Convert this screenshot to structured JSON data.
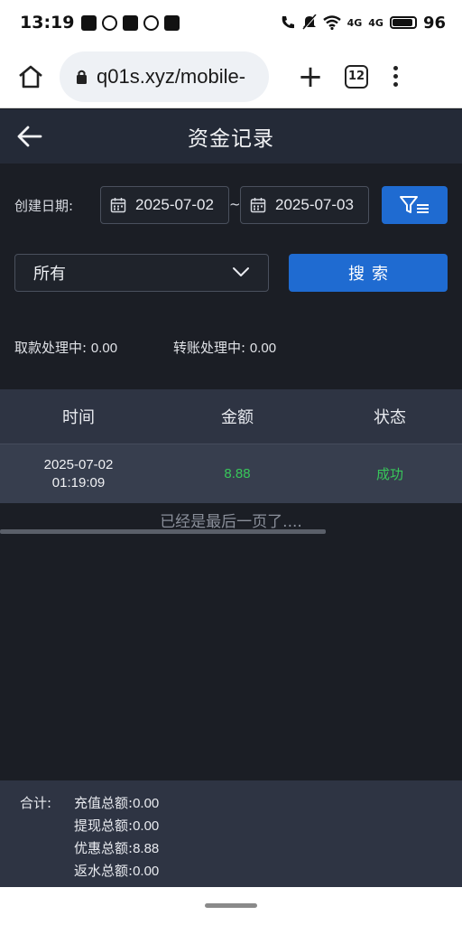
{
  "status_bar": {
    "time": "13:19",
    "battery": "96",
    "signal_labels": [
      "4G",
      "4G"
    ]
  },
  "browser": {
    "url": "q01s.xyz/mobile-",
    "tab_count": "12"
  },
  "header": {
    "title": "资金记录"
  },
  "filters": {
    "date_label": "创建日期:",
    "start_date": "2025-07-02",
    "separator": "~",
    "end_date": "2025-07-03",
    "type_selected": "所有",
    "search_label": "搜索",
    "accent_color": "#1f6bd1"
  },
  "pending": {
    "withdraw_label": "取款处理中:",
    "withdraw_value": "0.00",
    "transfer_label": "转账处理中:",
    "transfer_value": "0.00"
  },
  "table": {
    "columns": [
      "时间",
      "金额",
      "状态"
    ],
    "rows": [
      {
        "date": "2025-07-02",
        "time": "01:19:09",
        "amount": "8.88",
        "status": "成功"
      }
    ],
    "status_color": "#38c75a",
    "end_note": "已经是最后一页了...."
  },
  "summary": {
    "label": "合计:",
    "items": [
      {
        "label": "充值总额:",
        "value": "0.00"
      },
      {
        "label": "提现总额:",
        "value": "0.00"
      },
      {
        "label": "优惠总额:",
        "value": "8.88"
      },
      {
        "label": "返水总额:",
        "value": "0.00"
      }
    ]
  }
}
